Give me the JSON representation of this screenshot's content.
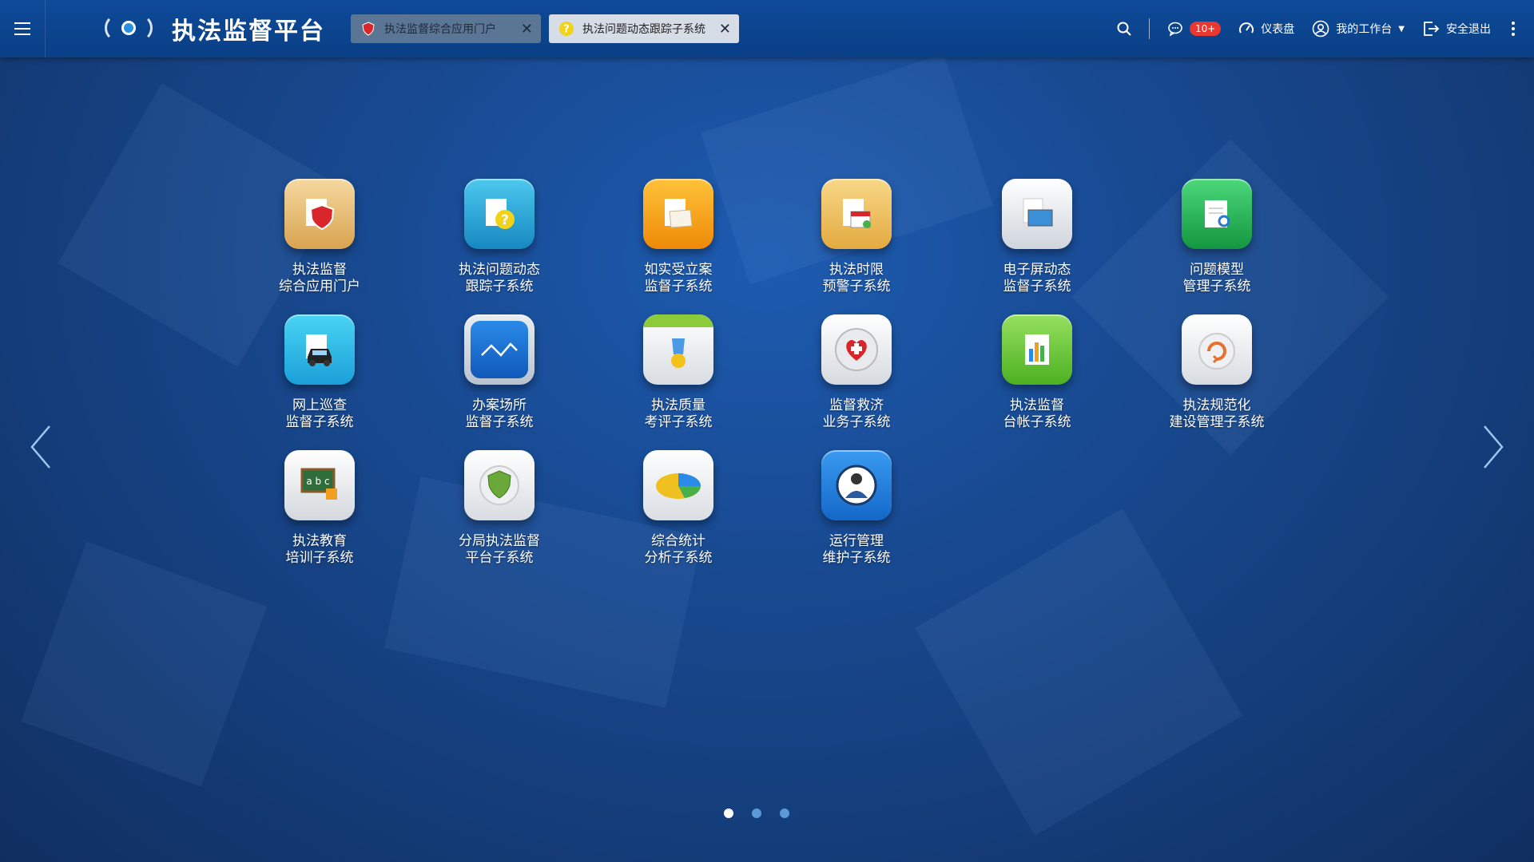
{
  "header": {
    "title": "执法监督平台",
    "tabs": [
      {
        "label": "执法监督综合应用门户",
        "icon": "shield-icon"
      },
      {
        "label": "执法问题动态跟踪子系统",
        "icon": "question-icon"
      }
    ],
    "notification_badge": "10+",
    "dashboard_label": "仪表盘",
    "workspace_label": "我的工作台",
    "logout_label": "安全退出"
  },
  "apps": [
    {
      "line1": "执法监督",
      "line2": "综合应用门户",
      "color": "#e8b86a",
      "icon": "shield-icon"
    },
    {
      "line1": "执法问题动态",
      "line2": "跟踪子系统",
      "color": "#2aa8d8",
      "icon": "question-icon"
    },
    {
      "line1": "如实受立案",
      "line2": "监督子系统",
      "color": "#f6a21a",
      "icon": "folder-icon"
    },
    {
      "line1": "执法时限",
      "line2": "预警子系统",
      "color": "#f0c05a",
      "icon": "calendar-icon"
    },
    {
      "line1": "电子屏动态",
      "line2": "监督子系统",
      "color": "#e6e9ee",
      "icon": "screen-icon"
    },
    {
      "line1": "问题模型",
      "line2": "管理子系统",
      "color": "#27b45a",
      "icon": "document-search-icon"
    },
    {
      "line1": "网上巡查",
      "line2": "监督子系统",
      "color": "#2ab8e8",
      "icon": "police-car-icon"
    },
    {
      "line1": "办案场所",
      "line2": "监督子系统",
      "color": "#1a6cd0",
      "icon": "line-chart-icon"
    },
    {
      "line1": "执法质量",
      "line2": "考评子系统",
      "color": "#eef0f2",
      "icon": "medal-icon"
    },
    {
      "line1": "监督救济",
      "line2": "业务子系统",
      "color": "#e8eaee",
      "icon": "heart-icon"
    },
    {
      "line1": "执法监督",
      "line2": "台帐子系统",
      "color": "#6ac83a",
      "icon": "bar-chart-icon"
    },
    {
      "line1": "执法规范化",
      "line2": "建设管理子系统",
      "color": "#eceef0",
      "icon": "refresh-icon"
    },
    {
      "line1": "执法教育",
      "line2": "培训子系统",
      "color": "#e6e8ea",
      "icon": "blackboard-icon"
    },
    {
      "line1": "分局执法监督",
      "line2": "平台子系统",
      "color": "#eef0f2",
      "icon": "shield-check-icon"
    },
    {
      "line1": "综合统计",
      "line2": "分析子系统",
      "color": "#f0f2f4",
      "icon": "pie-chart-icon"
    },
    {
      "line1": "运行管理",
      "line2": "维护子系统",
      "color": "#1e7ee0",
      "icon": "worker-icon"
    }
  ],
  "pager": {
    "pages": 3,
    "current": 1
  }
}
